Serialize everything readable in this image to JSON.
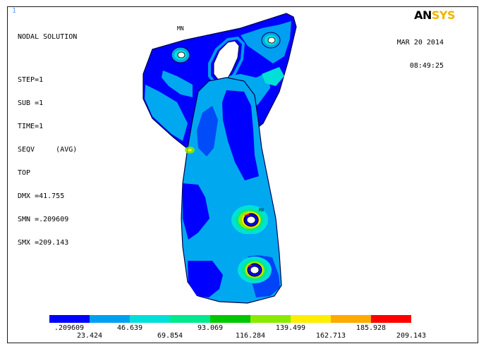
{
  "window": {
    "number": "1"
  },
  "info": {
    "title": "NODAL SOLUTION",
    "lines": [
      "STEP=1",
      "SUB =1",
      "TIME=1",
      "SEQV     (AVG)",
      "TOP",
      "DMX =41.755",
      "SMN =.209609",
      "SMX =209.143"
    ]
  },
  "timestamp": {
    "date": "MAR 20 2014",
    "time": "08:49:25"
  },
  "logo": {
    "part1": "AN",
    "part2": "SYS"
  },
  "markers": {
    "mn": "MN",
    "mx": "MX"
  },
  "legend": {
    "colors": [
      "#0000ff",
      "#00a0f0",
      "#00e0d8",
      "#00e890",
      "#00c800",
      "#8aea00",
      "#ffee00",
      "#ffaa00",
      "#ff0000"
    ],
    "labels_top": [
      ".209609",
      "46.639",
      "93.069",
      "139.499",
      "185.928"
    ],
    "labels_bottom": [
      "23.424",
      "69.854",
      "116.284",
      "162.713",
      "209.143"
    ]
  },
  "colors": {
    "frame": "#1a1a1a",
    "background": "#ffffff",
    "contour_min": "#0000ff",
    "contour_mid": "#00a8f0",
    "contour_max": "#ff0000"
  }
}
